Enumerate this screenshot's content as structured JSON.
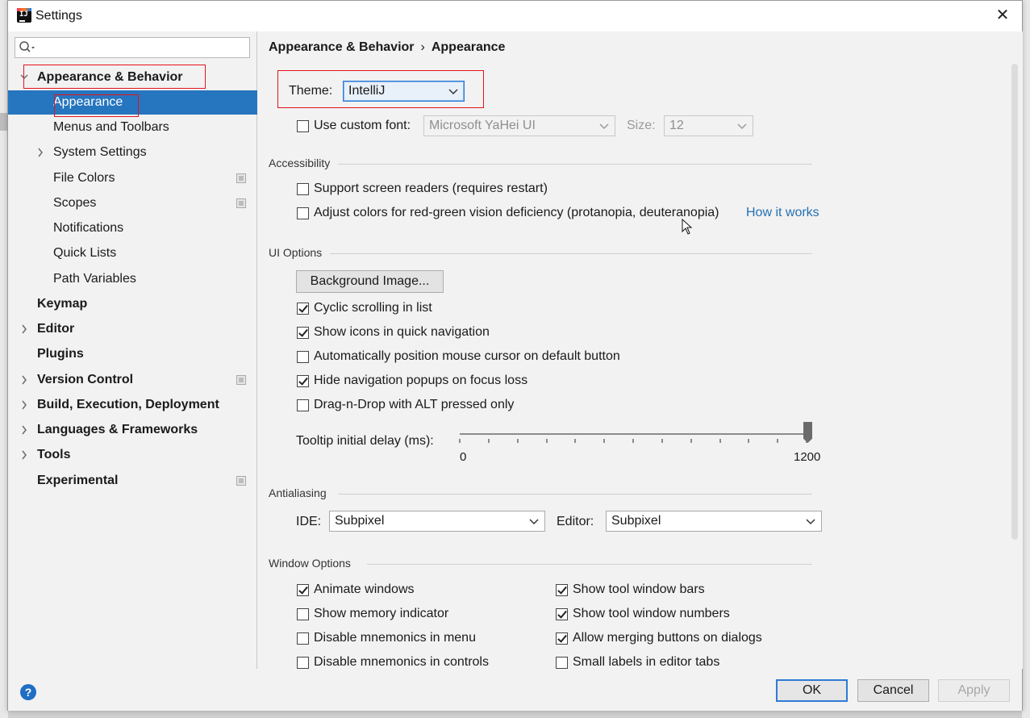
{
  "window": {
    "title": "Settings"
  },
  "sidebar": {
    "search_placeholder": "",
    "items": [
      {
        "label": "Appearance & Behavior",
        "bold": true,
        "expanded": true,
        "icon": "chevron-down-icon"
      },
      {
        "label": "Appearance",
        "selected": true
      },
      {
        "label": "Menus and Toolbars"
      },
      {
        "label": "System Settings",
        "icon": "chevron-right-icon"
      },
      {
        "label": "File Colors",
        "project_level": true
      },
      {
        "label": "Scopes",
        "project_level": true
      },
      {
        "label": "Notifications"
      },
      {
        "label": "Quick Lists"
      },
      {
        "label": "Path Variables"
      },
      {
        "label": "Keymap",
        "bold": true
      },
      {
        "label": "Editor",
        "bold": true,
        "icon": "chevron-right-icon"
      },
      {
        "label": "Plugins",
        "bold": true
      },
      {
        "label": "Version Control",
        "bold": true,
        "icon": "chevron-right-icon",
        "project_level": true
      },
      {
        "label": "Build, Execution, Deployment",
        "bold": true,
        "icon": "chevron-right-icon"
      },
      {
        "label": "Languages & Frameworks",
        "bold": true,
        "icon": "chevron-right-icon"
      },
      {
        "label": "Tools",
        "bold": true,
        "icon": "chevron-right-icon"
      },
      {
        "label": "Experimental",
        "bold": true,
        "project_level": true
      }
    ]
  },
  "breadcrumb": {
    "parent": "Appearance & Behavior",
    "separator": "›",
    "current": "Appearance"
  },
  "theme": {
    "label": "Theme:",
    "value": "IntelliJ"
  },
  "custom_font": {
    "label": "Use custom font:",
    "checked": false,
    "font_value": "Microsoft YaHei UI",
    "size_label": "Size:",
    "size_value": "12"
  },
  "accessibility": {
    "title": "Accessibility",
    "screen_readers": {
      "label": "Support screen readers (requires restart)",
      "checked": false
    },
    "color_deficiency": {
      "label": "Adjust colors for red-green vision deficiency (protanopia, deuteranopia)",
      "checked": false
    },
    "how_it_works": "How it works"
  },
  "ui_options": {
    "title": "UI Options",
    "background_image_button": "Background Image...",
    "options": [
      {
        "label": "Cyclic scrolling in list",
        "checked": true
      },
      {
        "label": "Show icons in quick navigation",
        "checked": true
      },
      {
        "label": "Automatically position mouse cursor on default button",
        "checked": false
      },
      {
        "label": "Hide navigation popups on focus loss",
        "checked": true
      },
      {
        "label": "Drag-n-Drop with ALT pressed only",
        "checked": false
      }
    ],
    "tooltip_delay": {
      "label": "Tooltip initial delay (ms):",
      "min": "0",
      "max": "1200",
      "value": 1200
    }
  },
  "antialiasing": {
    "title": "Antialiasing",
    "ide_label": "IDE:",
    "ide_value": "Subpixel",
    "editor_label": "Editor:",
    "editor_value": "Subpixel"
  },
  "window_options": {
    "title": "Window Options",
    "left": [
      {
        "label": "Animate windows",
        "checked": true
      },
      {
        "label": "Show memory indicator",
        "checked": false
      },
      {
        "label": "Disable mnemonics in menu",
        "checked": false
      },
      {
        "label": "Disable mnemonics in controls",
        "checked": false
      }
    ],
    "right": [
      {
        "label": "Show tool window bars",
        "checked": true
      },
      {
        "label": "Show tool window numbers",
        "checked": true
      },
      {
        "label": "Allow merging buttons on dialogs",
        "checked": true
      },
      {
        "label": "Small labels in editor tabs",
        "checked": false
      }
    ]
  },
  "footer": {
    "help": "?",
    "ok": "OK",
    "cancel": "Cancel",
    "apply": "Apply"
  },
  "colors": {
    "selection": "#2675bf",
    "link": "#2470b3",
    "annotation": "#e2141b",
    "focus": "#2c7bd2"
  }
}
